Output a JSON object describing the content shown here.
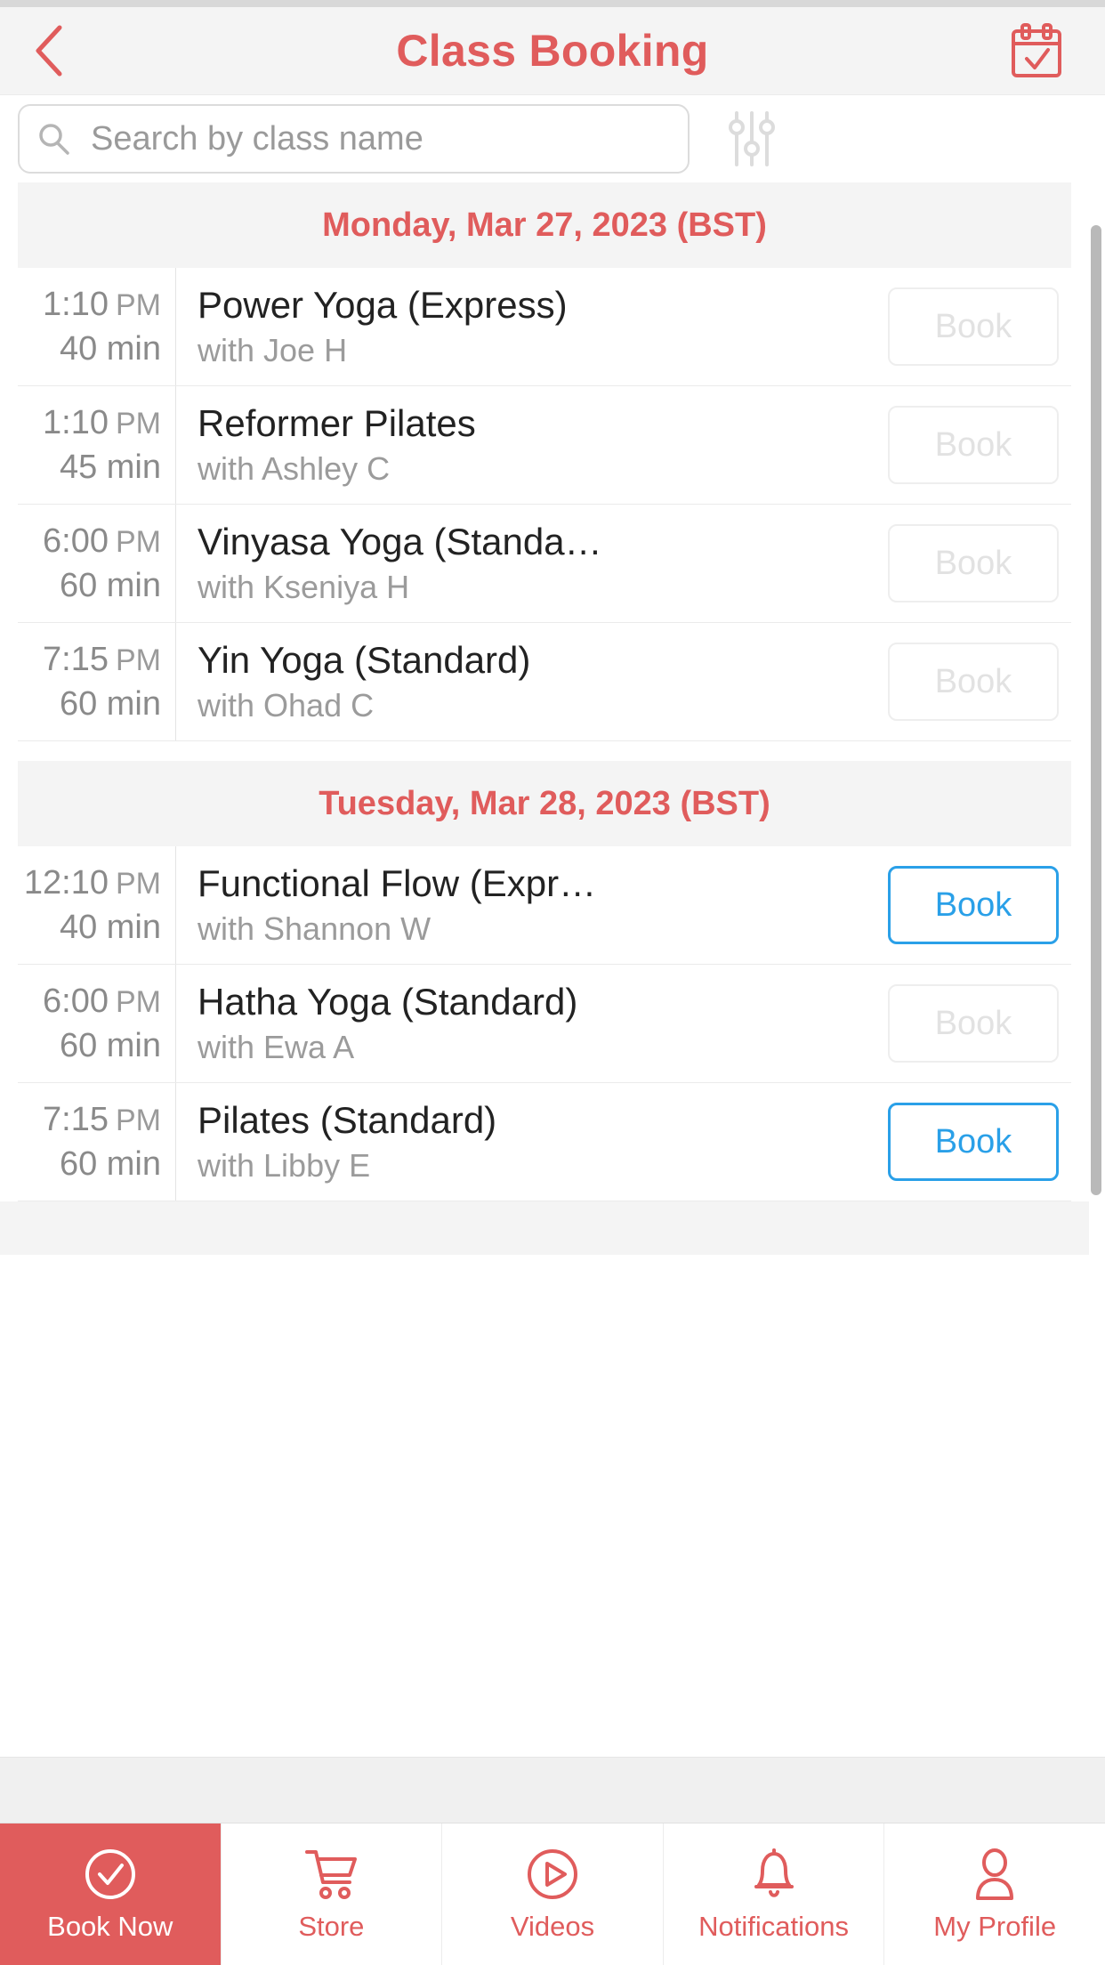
{
  "theme": {
    "accent": "#e05c5c",
    "link": "#2aa0e8",
    "muted": "#9a9a9a",
    "header_bg": "#f4f4f4"
  },
  "header": {
    "title": "Class Booking",
    "back_icon": "chevron-left-icon",
    "action_icon": "calendar-check-icon"
  },
  "search": {
    "placeholder": "Search by class name",
    "value": "",
    "search_icon": "search-icon",
    "filter_icon": "sliders-filter-icon"
  },
  "days": [
    {
      "label": "Monday, Mar 27, 2023 (BST)",
      "classes": [
        {
          "time": "1:10",
          "ampm": "PM",
          "duration": "40 min",
          "title": "Power Yoga (Express)",
          "instructor": "with Joe H",
          "book_label": "Book",
          "enabled": false
        },
        {
          "time": "1:10",
          "ampm": "PM",
          "duration": "45 min",
          "title": "Reformer Pilates",
          "instructor": "with Ashley C",
          "book_label": "Book",
          "enabled": false
        },
        {
          "time": "6:00",
          "ampm": "PM",
          "duration": "60 min",
          "title": "Vinyasa Yoga (Standa…",
          "instructor": "with Kseniya H",
          "book_label": "Book",
          "enabled": false
        },
        {
          "time": "7:15",
          "ampm": "PM",
          "duration": "60 min",
          "title": "Yin Yoga (Standard)",
          "instructor": "with Ohad C",
          "book_label": "Book",
          "enabled": false
        }
      ]
    },
    {
      "label": "Tuesday, Mar 28, 2023 (BST)",
      "classes": [
        {
          "time": "12:10",
          "ampm": "PM",
          "duration": "40 min",
          "title": "Functional Flow (Expr…",
          "instructor": "with Shannon W",
          "book_label": "Book",
          "enabled": true
        },
        {
          "time": "6:00",
          "ampm": "PM",
          "duration": "60 min",
          "title": "Hatha Yoga (Standard)",
          "instructor": "with Ewa A",
          "book_label": "Book",
          "enabled": false
        },
        {
          "time": "7:15",
          "ampm": "PM",
          "duration": "60 min",
          "title": "Pilates (Standard)",
          "instructor": "with Libby E",
          "book_label": "Book",
          "enabled": true
        }
      ]
    }
  ],
  "tabbar": {
    "items": [
      {
        "label": "Book Now",
        "icon": "check-circle-icon",
        "active": true
      },
      {
        "label": "Store",
        "icon": "shopping-cart-icon",
        "active": false
      },
      {
        "label": "Videos",
        "icon": "play-circle-icon",
        "active": false
      },
      {
        "label": "Notifications",
        "icon": "bell-icon",
        "active": false
      },
      {
        "label": "My Profile",
        "icon": "user-icon",
        "active": false
      }
    ]
  }
}
